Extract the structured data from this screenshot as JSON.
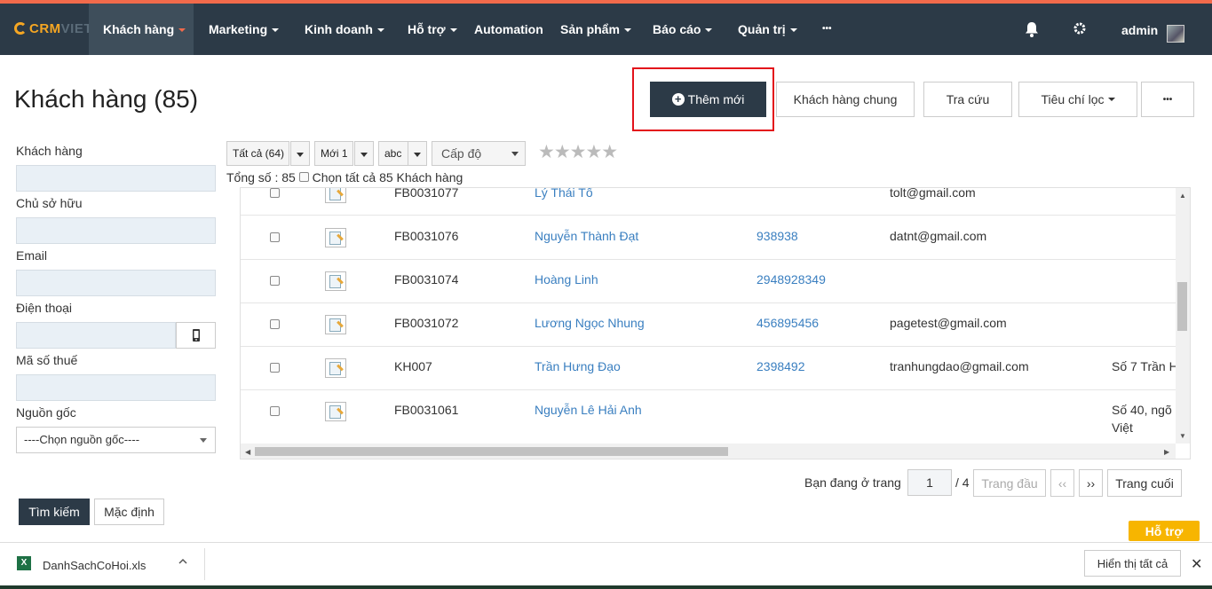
{
  "topnav": {
    "logo_crm": "CRM",
    "logo_viet": "VIET",
    "items": [
      {
        "label": "Khách hàng"
      },
      {
        "label": "Marketing"
      },
      {
        "label": "Kinh doanh"
      },
      {
        "label": "Hỗ trợ"
      },
      {
        "label": "Automation"
      },
      {
        "label": "Sản phẩm"
      },
      {
        "label": "Báo cáo"
      },
      {
        "label": "Quản trị"
      },
      {
        "label": "•••"
      }
    ],
    "user": "admin"
  },
  "page": {
    "title": "Khách hàng (85)",
    "add_new": "Thêm mới",
    "common_customers": "Khách hàng chung",
    "lookup": "Tra cứu",
    "filter_criteria": "Tiêu chí lọc",
    "more": "•••"
  },
  "filters": {
    "customer_label": "Khách hàng",
    "owner_label": "Chủ sở hữu",
    "email_label": "Email",
    "phone_label": "Điện thoại",
    "tax_label": "Mã số thuế",
    "source_label": "Nguồn gốc",
    "source_select": "----Chọn nguồn gốc----",
    "search_button": "Tìm kiếm",
    "default_button": "Mặc định"
  },
  "toolbar": {
    "all": "Tất cả (64)",
    "new": "Mới 1",
    "abc": "abc",
    "level": "Cấp độ",
    "stars": "★★★★★",
    "total": "Tổng số : 85",
    "select_all": "Chọn tất cả 85 Khách hàng"
  },
  "rows": [
    {
      "code": "FB0031077",
      "name": "Lý Thái Tổ",
      "phone": "",
      "email": "tolt@gmail.com",
      "address": ""
    },
    {
      "code": "FB0031076",
      "name": "Nguyễn Thành Đạt",
      "phone": "938938",
      "email": "datnt@gmail.com",
      "address": ""
    },
    {
      "code": "FB0031074",
      "name": "Hoàng Linh",
      "phone": "2948928349",
      "email": "",
      "address": ""
    },
    {
      "code": "FB0031072",
      "name": "Lương Ngọc Nhung",
      "phone": "456895456",
      "email": "pagetest@gmail.com",
      "address": ""
    },
    {
      "code": "KH007",
      "name": "Trần Hưng Đạo",
      "phone": "2398492",
      "email": "tranhungdao@gmail.com",
      "address": "Số 7 Trần H"
    },
    {
      "code": "FB0031061",
      "name": "Nguyễn Lê Hải Anh",
      "phone": "",
      "email": "",
      "address": "Số 40, ngõ\nViệt"
    }
  ],
  "pagination": {
    "label": "Bạn đang ở trang",
    "current": "1",
    "of": "/ 4",
    "first": "Trang đầu",
    "prev": "‹‹",
    "next": "››",
    "last": "Trang cuối"
  },
  "support": "Hỗ trợ",
  "download_bar": {
    "file": "DanhSachCoHoi.xls",
    "show_all": "Hiển thị tất cả",
    "close": "✕"
  }
}
